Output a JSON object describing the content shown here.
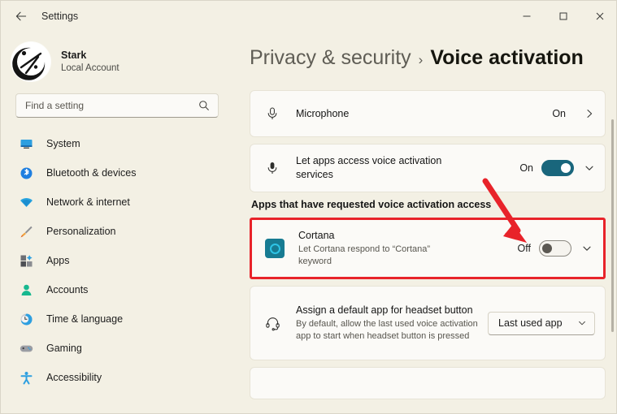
{
  "window": {
    "title": "Settings",
    "back_icon": "back-arrow-icon",
    "minimize_label": "–",
    "maximize_label": "□",
    "close_label": "×"
  },
  "account": {
    "name": "Stark",
    "type": "Local Account",
    "avatar_icon": "user-avatar-icon"
  },
  "search": {
    "placeholder": "Find a setting",
    "value": "",
    "icon": "search-icon"
  },
  "sidebar": {
    "items": [
      {
        "label": "System",
        "icon": "system-monitor-icon"
      },
      {
        "label": "Bluetooth & devices",
        "icon": "bluetooth-icon"
      },
      {
        "label": "Network & internet",
        "icon": "wifi-icon"
      },
      {
        "label": "Personalization",
        "icon": "paintbrush-icon"
      },
      {
        "label": "Apps",
        "icon": "apps-grid-icon"
      },
      {
        "label": "Accounts",
        "icon": "person-icon"
      },
      {
        "label": "Time & language",
        "icon": "clock-globe-icon"
      },
      {
        "label": "Gaming",
        "icon": "gamepad-icon"
      },
      {
        "label": "Accessibility",
        "icon": "accessibility-icon"
      }
    ]
  },
  "breadcrumb": {
    "parent": "Privacy & security",
    "separator": "›",
    "current": "Voice activation"
  },
  "main": {
    "microphone": {
      "title": "Microphone",
      "state": "On",
      "icon": "microphone-icon",
      "nav_icon": "chevron-right-icon"
    },
    "voice_access": {
      "title": "Let apps access voice activation services",
      "state": "On",
      "toggle_state": "on",
      "icon": "microphone-icon",
      "expand_icon": "chevron-down-icon"
    },
    "section_label": "Apps that have requested voice activation access",
    "cortana": {
      "title": "Cortana",
      "subtitle": "Let Cortana respond to “Cortana” keyword",
      "state": "Off",
      "toggle_state": "off",
      "icon": "cortana-icon",
      "expand_icon": "chevron-down-icon",
      "highlighted": true,
      "highlight_color": "#e8232a"
    },
    "headset": {
      "title": "Assign a default app for headset button",
      "subtitle": "By default, allow the last used voice activation app to start when headset button is pressed",
      "icon": "headset-icon",
      "dropdown_value": "Last used app",
      "dropdown_icon": "chevron-down-icon"
    }
  },
  "annotation": {
    "arrow_color": "#e8232a",
    "arrow_name": "red-pointer-arrow"
  },
  "colors": {
    "background": "#f3f0e4",
    "card": "#fbfaf7",
    "accent_toggle_on": "#19667c",
    "cortana_tile": "#177b92",
    "cortana_ring": "#2ec4e6",
    "highlight": "#e8232a"
  }
}
